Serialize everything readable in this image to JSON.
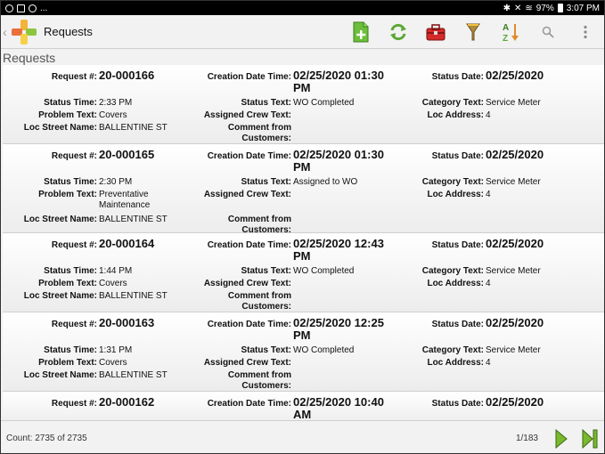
{
  "status_bar": {
    "left_text": "...",
    "battery": "97%",
    "time": "3:07 PM"
  },
  "app_bar": {
    "title": "Requests",
    "tools": [
      {
        "name": "add-document-icon",
        "color": "#5aa832"
      },
      {
        "name": "refresh-icon",
        "color": "#5aa832"
      },
      {
        "name": "toolbox-icon",
        "color": "#cc2222"
      },
      {
        "name": "filter-icon",
        "color": "#8a8a5a"
      },
      {
        "name": "sort-az-icon",
        "color": "#5aa832"
      },
      {
        "name": "search-icon",
        "color": "#999999"
      },
      {
        "name": "overflow-menu-icon",
        "color": "#888888"
      }
    ]
  },
  "page_title": "Requests",
  "labels": {
    "request": "Request #:",
    "creation": "Creation Date Time:",
    "status_date": "Status Date:",
    "status_time": "Status Time:",
    "status_text": "Status Text:",
    "category_text": "Category Text:",
    "problem_text": "Problem Text:",
    "assigned_crew": "Assigned Crew Text:",
    "loc_address": "Loc Address:",
    "loc_street": "Loc Street Name:",
    "comment_line1": "Comment from",
    "comment_line2": "Customers:"
  },
  "records": [
    {
      "request": "20-000166",
      "creation_line1": "02/25/2020 01:30",
      "creation_line2": "PM",
      "status_date": "02/25/2020",
      "status_time": "2:33 PM",
      "status_text": "WO Completed",
      "category_text": "Service Meter",
      "problem_line1": "Covers",
      "problem_line2": "",
      "assigned_crew": "",
      "loc_address": "4",
      "loc_street": "BALLENTINE ST"
    },
    {
      "request": "20-000165",
      "creation_line1": "02/25/2020 01:30",
      "creation_line2": "PM",
      "status_date": "02/25/2020",
      "status_time": "2:30 PM",
      "status_text": "Assigned to WO",
      "category_text": "Service Meter",
      "problem_line1": "Preventative",
      "problem_line2": "Maintenance",
      "assigned_crew": "",
      "loc_address": "4",
      "loc_street": "BALLENTINE ST"
    },
    {
      "request": "20-000164",
      "creation_line1": "02/25/2020 12:43",
      "creation_line2": "PM",
      "status_date": "02/25/2020",
      "status_time": "1:44 PM",
      "status_text": "WO Completed",
      "category_text": "Service Meter",
      "problem_line1": "Covers",
      "problem_line2": "",
      "assigned_crew": "",
      "loc_address": "4",
      "loc_street": "BALLENTINE ST"
    },
    {
      "request": "20-000163",
      "creation_line1": "02/25/2020 12:25",
      "creation_line2": "PM",
      "status_date": "02/25/2020",
      "status_time": "1:31 PM",
      "status_text": "WO Completed",
      "category_text": "Service Meter",
      "problem_line1": "Covers",
      "problem_line2": "",
      "assigned_crew": "",
      "loc_address": "4",
      "loc_street": "BALLENTINE ST"
    },
    {
      "request": "20-000162",
      "creation_line1": "02/25/2020 10:40",
      "creation_line2": "AM",
      "status_date": "02/25/2020",
      "status_time": "",
      "status_text": "",
      "category_text": "",
      "problem_line1": "",
      "problem_line2": "",
      "assigned_crew": "",
      "loc_address": "",
      "loc_street": ""
    }
  ],
  "footer": {
    "count_text": "Count: 2735 of 2735",
    "page_text": "1/183",
    "nav_color": "#6aa82a"
  }
}
